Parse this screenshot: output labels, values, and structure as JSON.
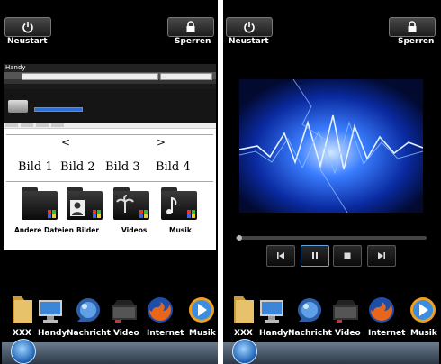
{
  "left_panel": {
    "restart_label": "Neustart",
    "lock_label": "Sperren",
    "explorer": {
      "title": "Handy",
      "nav_prev": "<",
      "nav_next": ">",
      "image_labels": [
        "Bild 1",
        "Bild 2",
        "Bild 3",
        "Bild 4"
      ],
      "folders": [
        {
          "label": "Andere Dateien",
          "icon": "folder-icon"
        },
        {
          "label": "Bilder",
          "icon": "folder-pictures-icon"
        },
        {
          "label": "Videos",
          "icon": "folder-videos-icon"
        },
        {
          "label": "Musik",
          "icon": "folder-music-icon"
        }
      ]
    },
    "dock": [
      {
        "label": "XXX",
        "icon": "folder-icon"
      },
      {
        "label": "Handy",
        "icon": "computer-icon"
      },
      {
        "label": "Nachricht",
        "icon": "messenger-icon"
      },
      {
        "label": "Video",
        "icon": "video-icon"
      },
      {
        "label": "Internet",
        "icon": "firefox-icon"
      },
      {
        "label": "Musik",
        "icon": "media-player-icon"
      }
    ]
  },
  "right_panel": {
    "restart_label": "Neustart",
    "lock_label": "Sperren",
    "player": {
      "progress": 0.02,
      "controls": [
        "previous-icon",
        "pause-icon",
        "stop-icon",
        "next-icon"
      ]
    },
    "dock": [
      {
        "label": "XXX",
        "icon": "folder-icon"
      },
      {
        "label": "Handy",
        "icon": "computer-icon"
      },
      {
        "label": "Nachricht",
        "icon": "messenger-icon"
      },
      {
        "label": "Video",
        "icon": "video-icon"
      },
      {
        "label": "Internet",
        "icon": "firefox-icon"
      },
      {
        "label": "Musik",
        "icon": "media-player-icon"
      }
    ]
  },
  "colors": {
    "background": "#000000",
    "taskbar_top": "#6a7c8e",
    "taskbar_bottom": "#2d3846",
    "video_blue": "#1e6bff"
  }
}
